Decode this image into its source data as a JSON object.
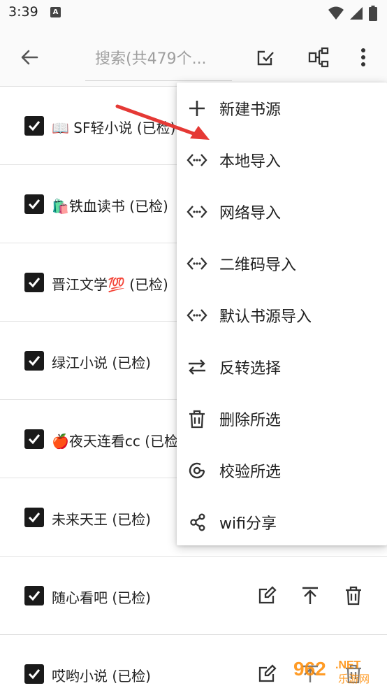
{
  "status_bar": {
    "time": "3:39",
    "app_icon_letter": "A"
  },
  "toolbar": {
    "search_placeholder": "搜索(共479个..."
  },
  "rows": [
    {
      "label": "📖 SF轻小说 (已检)"
    },
    {
      "label": "🛍️铁血读书 (已检)"
    },
    {
      "label": "晋江文学💯 (已检)"
    },
    {
      "label": "绿江小说 (已检)"
    },
    {
      "label": "🍎夜天连看cc (已检)"
    },
    {
      "label": "未来天王 (已检)"
    },
    {
      "label": "随心看吧 (已检)"
    },
    {
      "label": "哎哟小说 (已检)"
    }
  ],
  "menu": {
    "items": [
      {
        "label": "新建书源",
        "icon": "plus-icon"
      },
      {
        "label": "本地导入",
        "icon": "code-icon"
      },
      {
        "label": "网络导入",
        "icon": "code-icon"
      },
      {
        "label": "二维码导入",
        "icon": "code-icon"
      },
      {
        "label": "默认书源导入",
        "icon": "code-icon"
      },
      {
        "label": "反转选择",
        "icon": "swap-icon"
      },
      {
        "label": "删除所选",
        "icon": "trash-icon"
      },
      {
        "label": "校验所选",
        "icon": "verify-icon"
      },
      {
        "label": "wifi分享",
        "icon": "share-icon"
      }
    ]
  },
  "watermark": {
    "text": "962",
    "suffix": ".NET",
    "subtitle": "乐游网"
  },
  "colors": {
    "arrow": "#e53935",
    "checkbox": "#1a1a1a",
    "icon": "#333333"
  }
}
